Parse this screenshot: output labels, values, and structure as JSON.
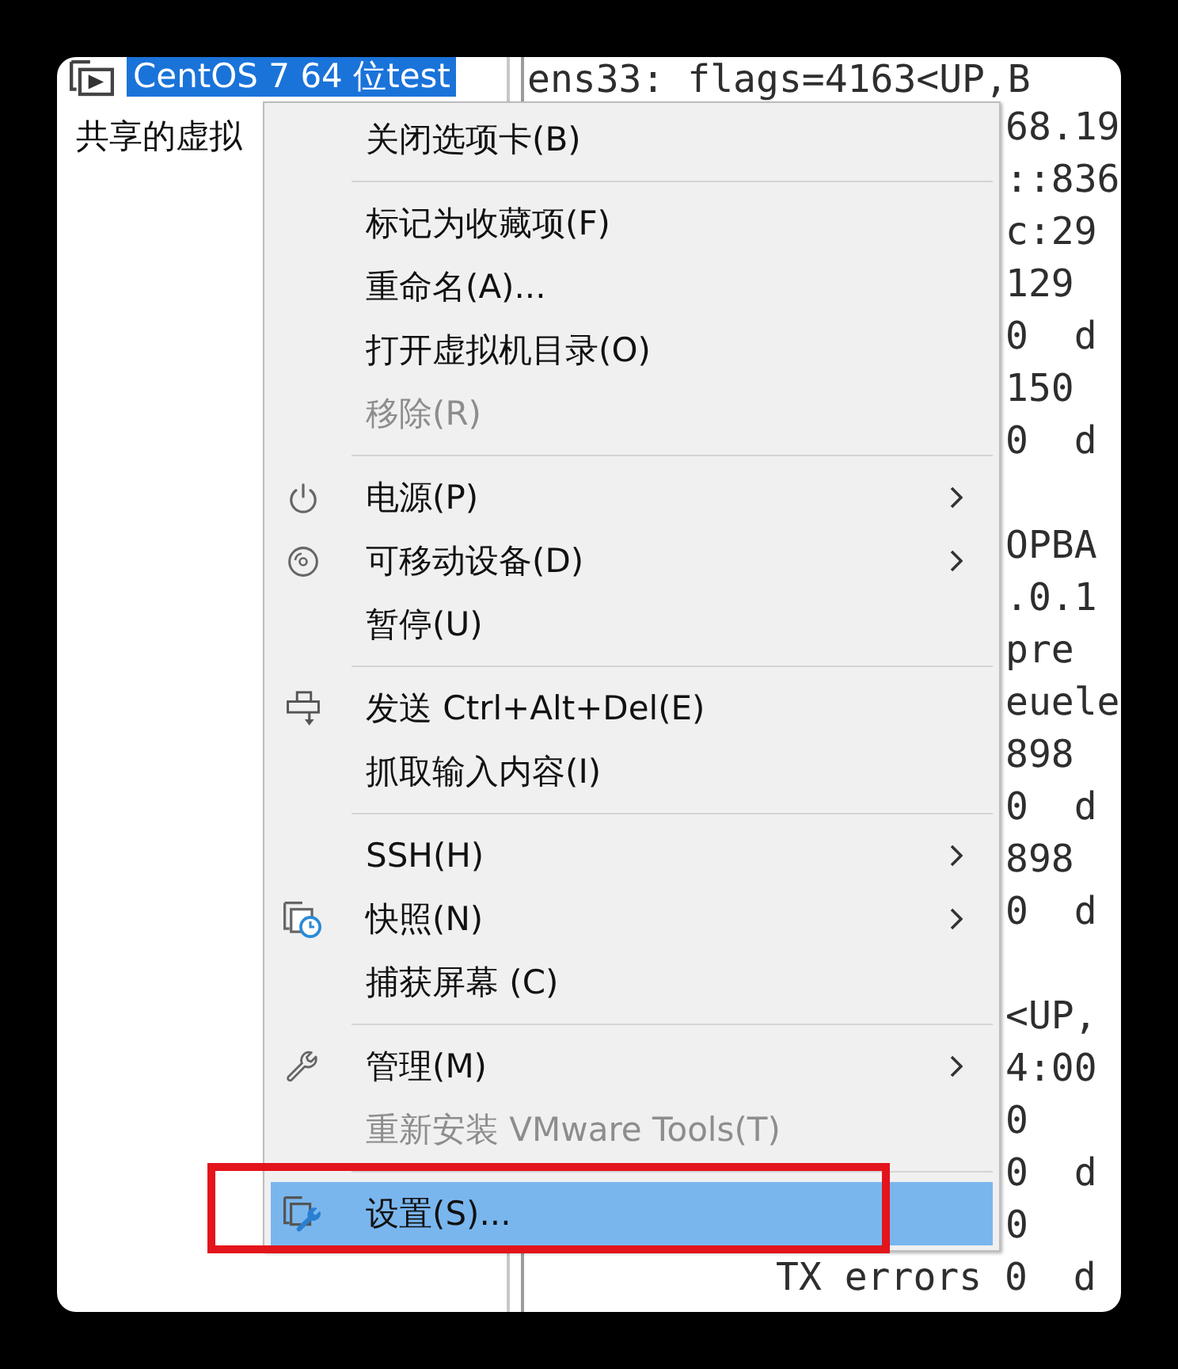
{
  "tree": {
    "items": [
      {
        "kind": "vm",
        "label": "CentOS 7 64 位test",
        "selected": true
      },
      {
        "kind": "group",
        "label": "共享的虚拟",
        "selected": false
      }
    ]
  },
  "context_menu": {
    "groups": [
      [
        {
          "label": "关闭选项卡(B)",
          "disabled": false,
          "submenu": false,
          "selected": false,
          "callout": false
        }
      ],
      [
        {
          "label": "标记为收藏项(F)",
          "disabled": false,
          "submenu": false,
          "selected": false,
          "callout": false
        },
        {
          "label": "重命名(A)...",
          "disabled": false,
          "submenu": false,
          "selected": false,
          "callout": false
        },
        {
          "label": "打开虚拟机目录(O)",
          "disabled": false,
          "submenu": false,
          "selected": false,
          "callout": false
        },
        {
          "label": "移除(R)",
          "disabled": true,
          "submenu": false,
          "selected": false,
          "callout": false
        }
      ],
      [
        {
          "label": "电源(P)",
          "disabled": false,
          "submenu": true,
          "selected": false,
          "callout": false
        },
        {
          "label": "可移动设备(D)",
          "disabled": false,
          "submenu": true,
          "selected": false,
          "callout": false
        },
        {
          "label": "暂停(U)",
          "disabled": false,
          "submenu": false,
          "selected": false,
          "callout": false
        }
      ],
      [
        {
          "label": "发送 Ctrl+Alt+Del(E)",
          "disabled": false,
          "submenu": false,
          "selected": false,
          "callout": false
        },
        {
          "label": "抓取输入内容(I)",
          "disabled": false,
          "submenu": false,
          "selected": false,
          "callout": false
        }
      ],
      [
        {
          "label": "SSH(H)",
          "disabled": false,
          "submenu": true,
          "selected": false,
          "callout": false
        },
        {
          "label": "快照(N)",
          "disabled": false,
          "submenu": true,
          "selected": false,
          "callout": false
        },
        {
          "label": "捕获屏幕 (C)",
          "disabled": false,
          "submenu": false,
          "selected": false,
          "callout": false
        }
      ],
      [
        {
          "label": "管理(M)",
          "disabled": false,
          "submenu": true,
          "selected": false,
          "callout": false
        },
        {
          "label": "重新安装 VMware Tools(T)",
          "disabled": true,
          "submenu": false,
          "selected": false,
          "callout": false
        }
      ],
      [
        {
          "label": "设置(S)...",
          "disabled": false,
          "submenu": false,
          "selected": true,
          "callout": true
        }
      ]
    ]
  },
  "terminal": {
    "blocks": [
      [
        {
          "kind": "full",
          "text": "ens33: flags=4163<UP,B"
        },
        {
          "kind": "side",
          "text": "68.19"
        },
        {
          "kind": "side",
          "text": "::836"
        },
        {
          "kind": "side",
          "text": "c:29"
        },
        {
          "kind": "side",
          "text": "129"
        },
        {
          "kind": "side",
          "text": "0  d"
        },
        {
          "kind": "side",
          "text": "150"
        },
        {
          "kind": "side",
          "text": "0  d"
        }
      ],
      [
        {
          "kind": "side",
          "text": "OPBA"
        },
        {
          "kind": "side",
          "text": ".0.1"
        },
        {
          "kind": "side",
          "text": "pre"
        },
        {
          "kind": "side",
          "text": "euele"
        },
        {
          "kind": "side",
          "text": "898"
        },
        {
          "kind": "side",
          "text": "0  d"
        },
        {
          "kind": "side",
          "text": "898"
        },
        {
          "kind": "side",
          "text": "0  d"
        }
      ],
      [
        {
          "kind": "side",
          "text": "<UP,"
        },
        {
          "kind": "side",
          "text": "4:00"
        },
        {
          "kind": "side",
          "text": "0"
        },
        {
          "kind": "side",
          "text": "0  d"
        },
        {
          "kind": "side",
          "text": "0"
        },
        {
          "kind": "tail",
          "text": "TX errors 0  d"
        }
      ]
    ]
  }
}
